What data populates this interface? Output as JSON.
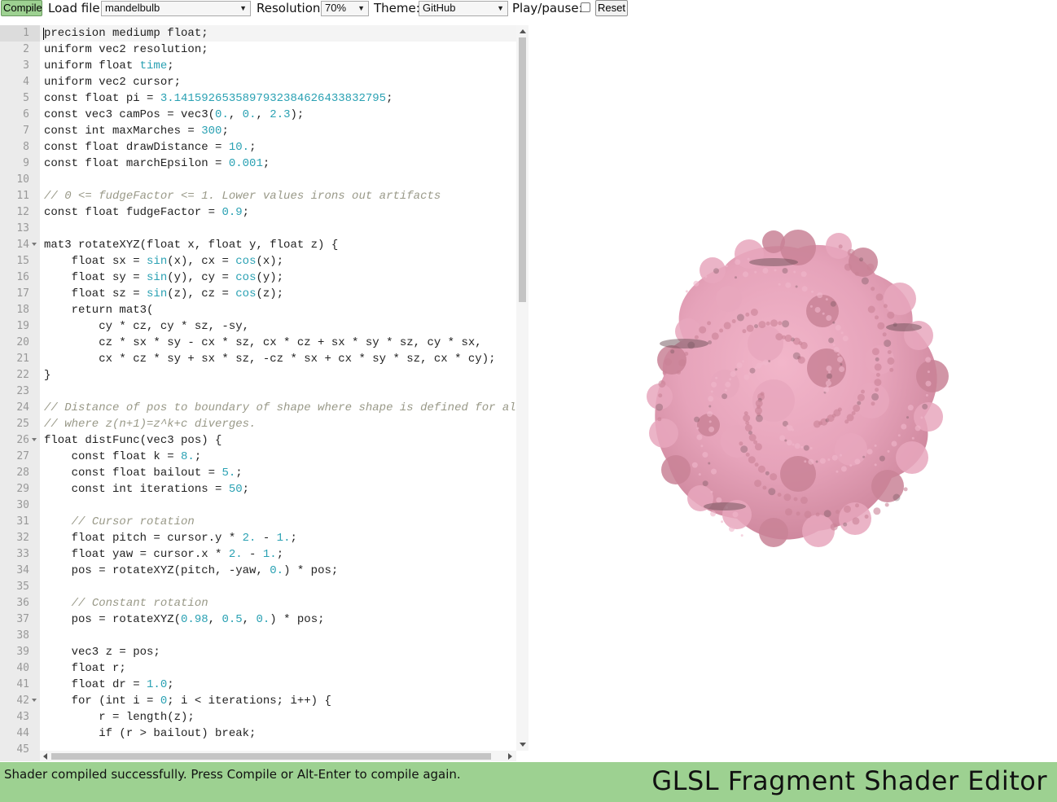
{
  "toolbar": {
    "compile_label": "Compile",
    "load_file_label": "Load file:",
    "load_file_value": "mandelbulb",
    "resolution_label": "Resolution:",
    "resolution_value": "70%",
    "theme_label": "Theme:",
    "theme_value": "GitHub",
    "play_pause_label": "Play/pause:",
    "play_checked": false,
    "reset_label": "Reset"
  },
  "editor": {
    "active_line": 1,
    "fold_lines": [
      14,
      26,
      42
    ],
    "lines": [
      "precision mediump float;",
      "uniform vec2 resolution;",
      "uniform float time;",
      "uniform vec2 cursor;",
      "const float pi = 3.1415926535897932384626433832795;",
      "const vec3 camPos = vec3(0., 0., 2.3);",
      "const int maxMarches = 300;",
      "const float drawDistance = 10.;",
      "const float marchEpsilon = 0.001;",
      "",
      "// 0 <= fudgeFactor <= 1. Lower values irons out artifacts",
      "const float fudgeFactor = 0.9;",
      "",
      "mat3 rotateXYZ(float x, float y, float z) {",
      "    float sx = sin(x), cx = cos(x);",
      "    float sy = sin(y), cy = cos(y);",
      "    float sz = sin(z), cz = cos(z);",
      "    return mat3(",
      "        cy * cz, cy * sz, -sy,",
      "        cz * sx * sy - cx * sz, cx * cz + sx * sy * sz, cy * sx,",
      "        cx * cz * sy + sx * sz, -cz * sx + cx * sy * sz, cx * cy);",
      "}",
      "",
      "// Distance of pos to boundary of shape where shape is defined for al",
      "// where z(n+1)=z^k+c diverges.",
      "float distFunc(vec3 pos) {",
      "    const float k = 8.;",
      "    const float bailout = 5.;",
      "    const int iterations = 50;",
      "",
      "    // Cursor rotation",
      "    float pitch = cursor.y * 2. - 1.;",
      "    float yaw = cursor.x * 2. - 1.;",
      "    pos = rotateXYZ(pitch, -yaw, 0.) * pos;",
      "",
      "    // Constant rotation",
      "    pos = rotateXYZ(0.98, 0.5, 0.) * pos;",
      "",
      "    vec3 z = pos;",
      "    float r;",
      "    float dr = 1.0;",
      "    for (int i = 0; i < iterations; i++) {",
      "        r = length(z);",
      "        if (r > bailout) break;",
      ""
    ]
  },
  "render": {
    "shape_color": "#e8a7bd",
    "shadow_color": "#c98296",
    "dark_color": "#6e5058"
  },
  "footer": {
    "status": "Shader compiled successfully. Press Compile or Alt-Enter to compile again.",
    "title": "GLSL Fragment Shader Editor",
    "background": "#9dd191"
  }
}
